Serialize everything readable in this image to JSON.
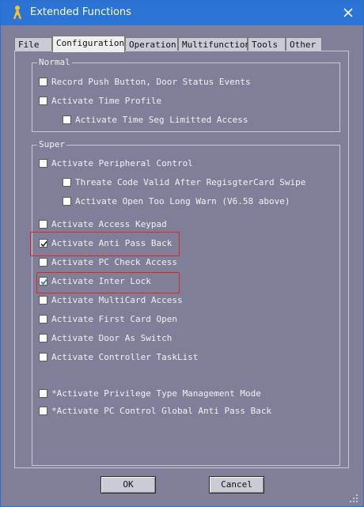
{
  "window": {
    "title": "Extended Functions",
    "title_icon": "key-person-icon",
    "close_icon": "close-icon"
  },
  "tabs": [
    {
      "label": "File",
      "active": false
    },
    {
      "label": "Configuration",
      "active": true
    },
    {
      "label": "Operation",
      "active": false
    },
    {
      "label": "Multifunction",
      "active": false
    },
    {
      "label": "Tools",
      "active": false
    },
    {
      "label": "Other",
      "active": false
    }
  ],
  "normal": {
    "title": "Normal",
    "items": [
      {
        "label": "Record Push Button, Door Status Events",
        "checked": false
      },
      {
        "label": "Activate Time Profile",
        "checked": false
      },
      {
        "label": "Activate Time Seg Limitted Access",
        "checked": false
      }
    ]
  },
  "super": {
    "title": "Super",
    "items": [
      {
        "label": "Activate Peripheral Control",
        "checked": false
      },
      {
        "label": "Threate Code Valid After RegisgterCard Swipe",
        "checked": false
      },
      {
        "label": "Activate Open Too Long Warn (V6.58 above)",
        "checked": false
      },
      {
        "label": "Activate Access Keypad",
        "checked": false
      },
      {
        "label": "Activate Anti Pass Back",
        "checked": true,
        "highlighted": true
      },
      {
        "label": "Activate PC Check Access",
        "checked": false
      },
      {
        "label": "Activate Inter Lock",
        "checked": true,
        "highlighted": true
      },
      {
        "label": "Activate MultiCard Access",
        "checked": false
      },
      {
        "label": "Activate First Card Open",
        "checked": false
      },
      {
        "label": "Activate Door As Switch",
        "checked": false
      },
      {
        "label": "Activate Controller TaskList",
        "checked": false
      },
      {
        "label": "*Activate Privilege Type Management Mode",
        "checked": false
      },
      {
        "label": "*Activate PC Control Global Anti Pass Back",
        "checked": false
      }
    ]
  },
  "buttons": {
    "ok": "OK",
    "cancel": "Cancel"
  },
  "colors": {
    "titlebar": "#2b73d4",
    "panel": "#7f7f9a",
    "highlight": "#e02424",
    "check_inter_lock": "#2a6fbf"
  }
}
